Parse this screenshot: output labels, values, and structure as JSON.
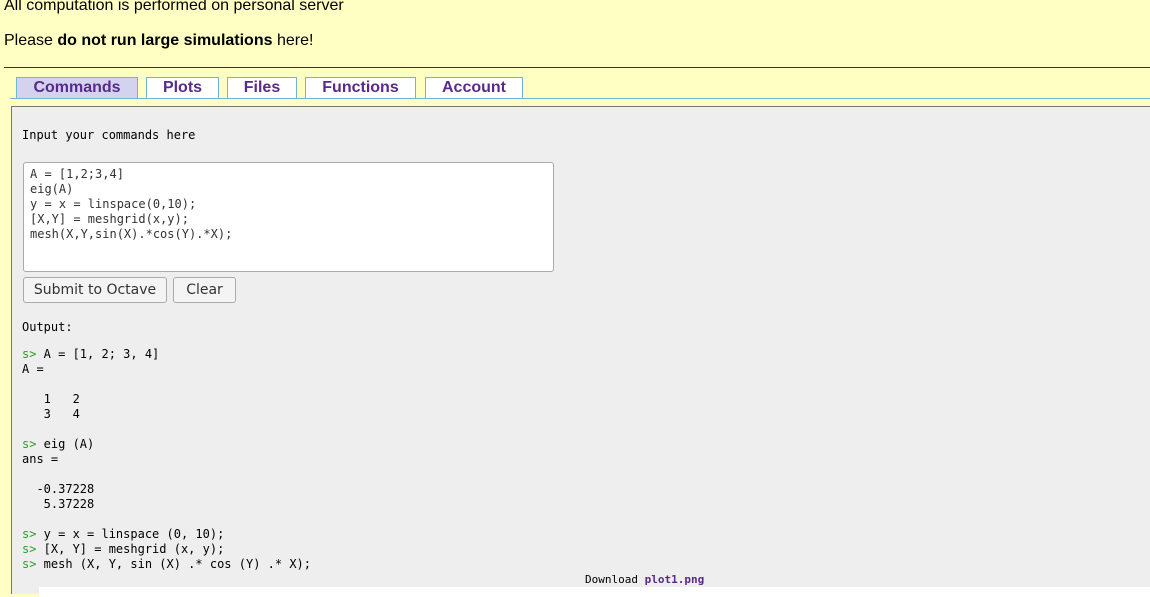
{
  "notice": {
    "line1": "All computation is performed on personal server",
    "line2_pre": "Please ",
    "line2_bold": "do not run large simulations",
    "line2_post": " here!"
  },
  "tabs": [
    {
      "label": "Commands",
      "active": true
    },
    {
      "label": "Plots",
      "active": false
    },
    {
      "label": "Files",
      "active": false
    },
    {
      "label": "Functions",
      "active": false
    },
    {
      "label": "Account",
      "active": false
    }
  ],
  "commands": {
    "input_label": "Input your commands here",
    "input_value": "A = [1,2;3,4]\neig(A)\ny = x = linspace(0,10);\n[X,Y] = meshgrid(x,y);\nmesh(X,Y,sin(X).*cos(Y).*X);",
    "submit_label": "Submit to Octave",
    "clear_label": "Clear"
  },
  "output": {
    "label": "Output:",
    "prompt_symbol": "s>",
    "lines": [
      {
        "type": "prompt",
        "text": " A = [1, 2; 3, 4]"
      },
      {
        "type": "text",
        "text": "A ="
      },
      {
        "type": "text",
        "text": ""
      },
      {
        "type": "text",
        "text": "   1   2"
      },
      {
        "type": "text",
        "text": "   3   4"
      },
      {
        "type": "text",
        "text": ""
      },
      {
        "type": "prompt",
        "text": " eig (A)"
      },
      {
        "type": "text",
        "text": "ans ="
      },
      {
        "type": "text",
        "text": ""
      },
      {
        "type": "text",
        "text": "  -0.37228"
      },
      {
        "type": "text",
        "text": "   5.37228"
      },
      {
        "type": "text",
        "text": ""
      },
      {
        "type": "prompt",
        "text": " y = x = linspace (0, 10);"
      },
      {
        "type": "prompt",
        "text": " [X, Y] = meshgrid (x, y);"
      },
      {
        "type": "prompt",
        "text": " mesh (X, Y, sin (X) .* cos (Y) .* X);"
      }
    ]
  },
  "download": {
    "label": "Download ",
    "file": "plot1.png"
  },
  "colors": {
    "page_background": "#ffffc4",
    "tab_text": "#5a2a8a",
    "tab_border": "#6cb6d6",
    "active_tab": "#d3d3ef",
    "prompt": "#2e9c2e"
  }
}
